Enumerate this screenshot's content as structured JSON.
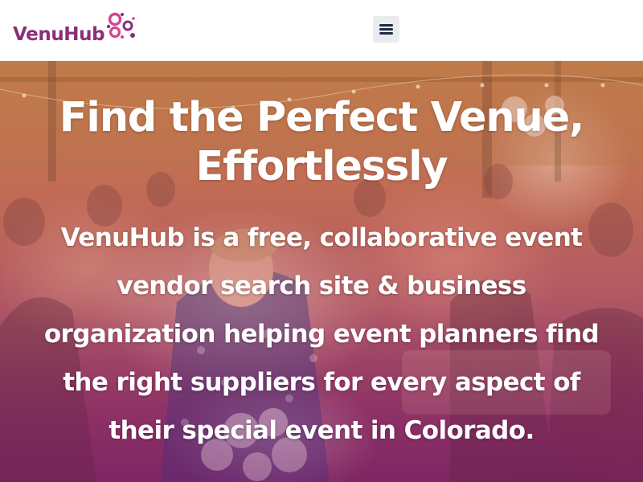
{
  "header": {
    "logo": {
      "text": "VenuHub",
      "icon": "flower-dots-logo-mark"
    },
    "menu": {
      "icon": "hamburger-menu-icon"
    }
  },
  "hero": {
    "background": "photo-of-event-guests-at-dinner",
    "title": "Find the Perfect Venue, Effortlessly",
    "subtitle": "VenuHub is a free, collaborative event vendor search site & business organization helping event planners find the right suppliers for every aspect of their special event in Colorado."
  },
  "colors": {
    "brand_purple": "#8a2f7a",
    "brand_pink": "#d9428e",
    "menu_button_bg": "#e9ebef",
    "menu_icon": "#1f2a44",
    "hero_text": "#ffffff"
  }
}
